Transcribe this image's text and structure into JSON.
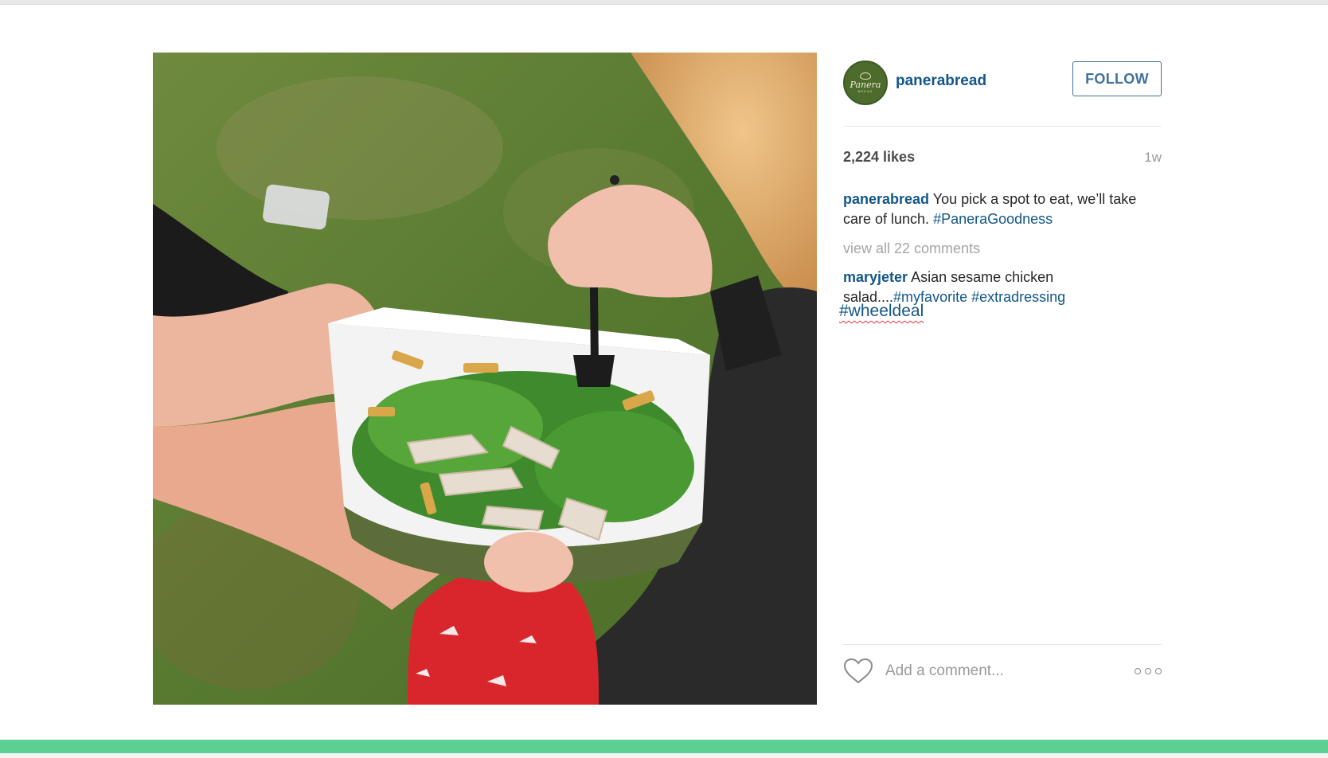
{
  "post": {
    "username": "panerabread",
    "follow_label": "FOLLOW",
    "avatar_text": "Panera",
    "avatar_subtext": "BREAD",
    "likes": "2,224 likes",
    "age": "1w",
    "caption": {
      "user": "panerabread",
      "text": "You pick a spot to eat, we’ll take care of lunch.",
      "tag": "#PaneraGoodness"
    },
    "view_all": "view all 22 comments",
    "comment": {
      "user": "maryjeter",
      "text": "Asian sesame chicken salad....",
      "tag1": "#myfavorite",
      "tag2": "#extradressing",
      "tag3": "#wheeldeal"
    },
    "add_comment_placeholder": "Add a comment...",
    "icons": {
      "like": "heart-icon",
      "more": "more-options-icon"
    }
  },
  "colors": {
    "link": "#125688",
    "follow_border": "#3f729b",
    "accent_bar": "#5ecf92"
  }
}
